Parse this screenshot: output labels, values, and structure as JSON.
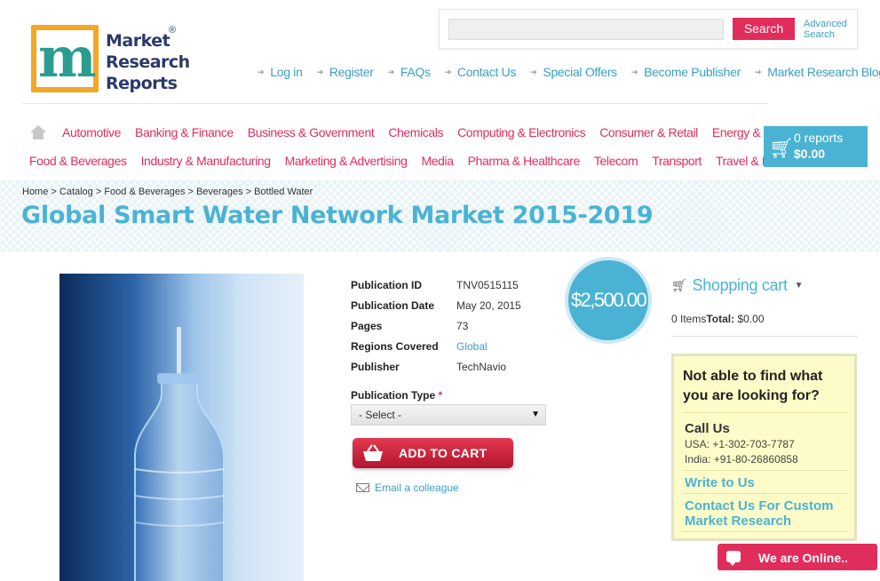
{
  "logo": {
    "line1": "Market",
    "line2": "Research",
    "line3": "Reports",
    "reg": "®",
    "letter": "m"
  },
  "search": {
    "placeholder": "",
    "button_label": "Search",
    "advanced_line1": "Advanced",
    "advanced_line2": "Search"
  },
  "top_nav": [
    "Log in",
    "Register",
    "FAQs",
    "Contact Us",
    "Special Offers",
    "Become Publisher",
    "Market Research Blog"
  ],
  "categories_row1": [
    "Automotive",
    "Banking & Finance",
    "Business & Government",
    "Chemicals",
    "Computing & Electronics",
    "Consumer & Retail",
    "Energy & Utilities"
  ],
  "categories_row2": [
    "Food & Beverages",
    "Industry & Manufacturing",
    "Marketing & Advertising",
    "Media",
    "Pharma & Healthcare",
    "Telecom",
    "Transport",
    "Travel & Leisure"
  ],
  "cart": {
    "count": "0 reports",
    "total": "$0.00"
  },
  "breadcrumb": "Home > Catalog > Food & Beverages > Beverages > Bottled Water",
  "title": "Global Smart Water Network Market 2015-2019",
  "price": "$2,500.00",
  "details": [
    {
      "label": "Publication ID",
      "value": "TNV0515115",
      "link": false
    },
    {
      "label": "Publication Date",
      "value": "May 20, 2015",
      "link": false
    },
    {
      "label": "Pages",
      "value": "73",
      "link": false
    },
    {
      "label": "Regions Covered",
      "value": "Global",
      "link": true
    },
    {
      "label": "Publisher",
      "value": "TechNavio",
      "link": false
    }
  ],
  "publication_type": {
    "label": "Publication Type",
    "required": "*",
    "selected": "- Select -"
  },
  "add_to_cart": "ADD TO CART",
  "email_colleague": "Email a colleague",
  "shopping_cart": {
    "title": "Shopping cart",
    "items": "0 Items",
    "total_label": "Total:",
    "total_value": "$0.00"
  },
  "help": {
    "title": "Not able to find what you are looking for?",
    "call_us": "Call Us",
    "usa": "USA: +1-302-703-7787",
    "india": "India: +91-80-26860858",
    "write": "Write to Us",
    "custom": "Contact Us For Custom Market Research"
  },
  "chat": "We are Online..",
  "colors": {
    "accent_pink": "#e12d5c",
    "accent_blue": "#4ab3d4",
    "logo_orange": "#f5a623"
  }
}
